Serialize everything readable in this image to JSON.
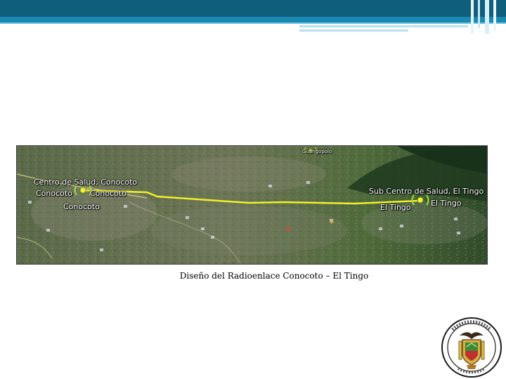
{
  "map": {
    "top_marker_label": "Guangopolo",
    "site_a_title": "Centro de Salud, Conocoto",
    "site_a_left": "Conocoto",
    "site_a_right": "Conocoto",
    "site_a_below": "Conocoto",
    "site_b_title": "Sub Centro de Salud, El Tingo",
    "site_b_left": "El Tingo",
    "site_b_right": "El Tingo"
  },
  "caption": "Diseño del Radioenlace Conocoto – El Tingo"
}
